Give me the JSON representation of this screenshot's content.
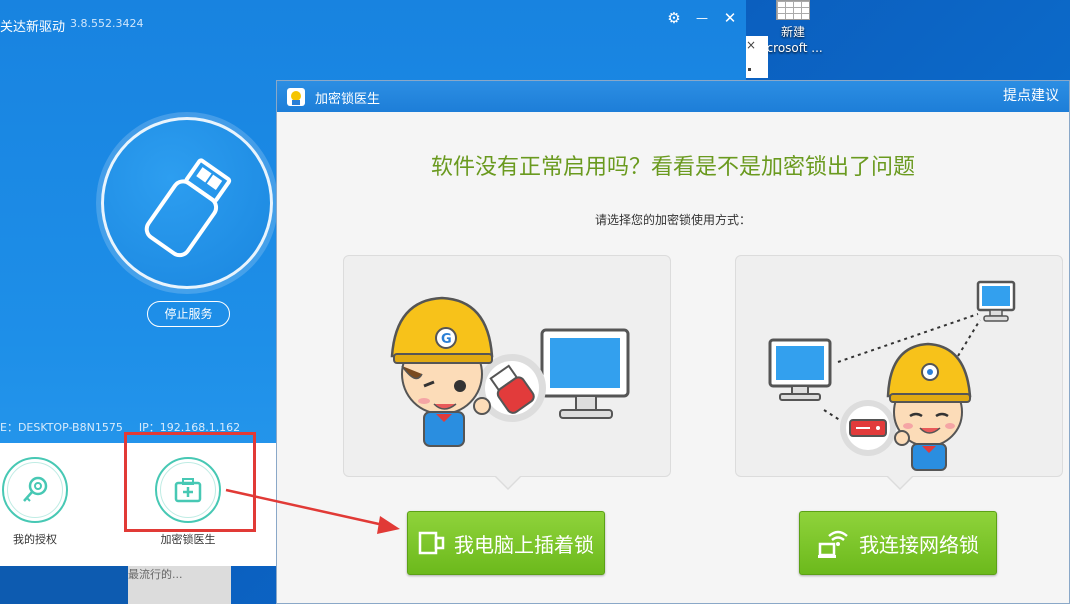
{
  "desktop": {
    "shortcut": {
      "line1": "新建",
      "line2": "icrosoft ..."
    }
  },
  "popup": {
    "close": "×"
  },
  "driver": {
    "title": "关达新驱动",
    "version": "3.8.552.3424",
    "settings_glyph": "⚙",
    "minimize_glyph": "—",
    "close_glyph": "✕",
    "stop_service": "停止服务",
    "host_label": "E：DESKTOP-B8N1575",
    "ip_label": "IP：192.168.1.162",
    "tools": [
      {
        "label": "我的授权"
      },
      {
        "label": "加密锁医生"
      }
    ],
    "taskbar_text": "最流行的..."
  },
  "doctor": {
    "title": "加密锁医生",
    "feedback": "提点建议",
    "headline": "软件没有正常启用吗？看看是不是加密锁出了问题",
    "subline": "请选择您的加密锁使用方式：",
    "buttons": {
      "local": "我电脑上插着锁",
      "network": "我连接网络锁"
    }
  },
  "colors": {
    "accent_blue": "#1e8fe8",
    "headline_green": "#6a9a1f",
    "button_green": "#7cc52a",
    "highlight_red": "#e13a36",
    "teal_ring": "#47c8b4"
  }
}
